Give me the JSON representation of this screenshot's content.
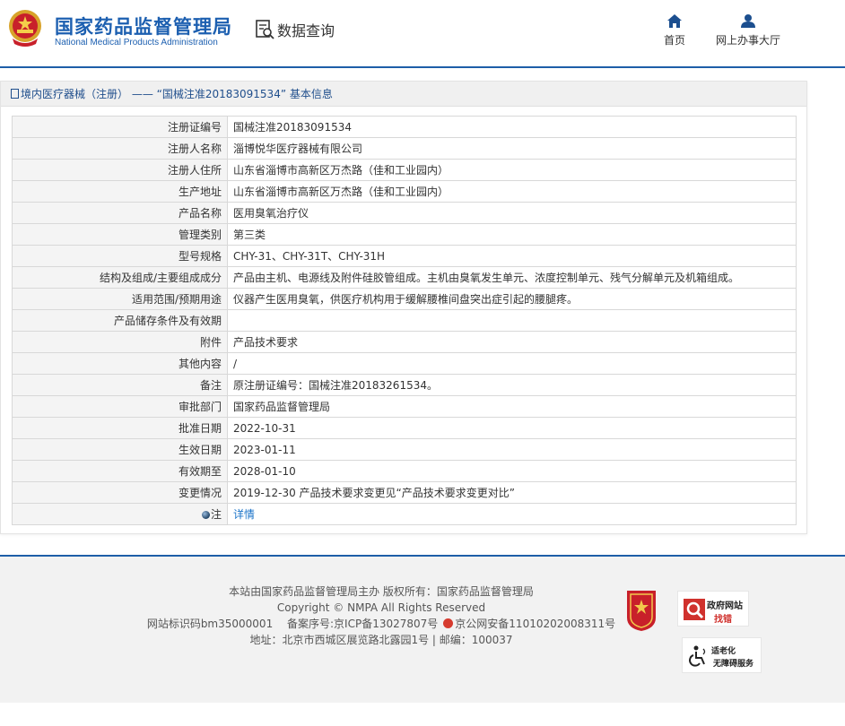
{
  "header": {
    "brand_cn": "国家药品监督管理局",
    "brand_en": "National Medical Products Administration",
    "query_label": "数据查询",
    "nav": {
      "home": "首页",
      "hall": "网上办事大厅"
    }
  },
  "breadcrumb": "境内医疗器械（注册） —— “国械注准20183091534” 基本信息",
  "fields": [
    {
      "label": "注册证编号",
      "value": "国械注准20183091534"
    },
    {
      "label": "注册人名称",
      "value": "淄博悦华医疗器械有限公司"
    },
    {
      "label": "注册人住所",
      "value": "山东省淄博市高新区万杰路（佳和工业园内）"
    },
    {
      "label": "生产地址",
      "value": "山东省淄博市高新区万杰路（佳和工业园内）"
    },
    {
      "label": "产品名称",
      "value": "医用臭氧治疗仪"
    },
    {
      "label": "管理类别",
      "value": "第三类"
    },
    {
      "label": "型号规格",
      "value": "CHY-31、CHY-31T、CHY-31H"
    },
    {
      "label": "结构及组成/主要组成成分",
      "value": "产品由主机、电源线及附件硅胶管组成。主机由臭氧发生单元、浓度控制单元、残气分解单元及机箱组成。"
    },
    {
      "label": "适用范围/预期用途",
      "value": "仪器产生医用臭氧，供医疗机构用于缓解腰椎间盘突出症引起的腰腿疼。"
    },
    {
      "label": "产品储存条件及有效期",
      "value": ""
    },
    {
      "label": "附件",
      "value": "产品技术要求"
    },
    {
      "label": "其他内容",
      "value": "/"
    },
    {
      "label": "备注",
      "value": "原注册证编号：国械注准20183261534。"
    },
    {
      "label": "审批部门",
      "value": "国家药品监督管理局"
    },
    {
      "label": "批准日期",
      "value": "2022-10-31"
    },
    {
      "label": "生效日期",
      "value": "2023-01-11"
    },
    {
      "label": "有效期至",
      "value": "2028-01-10"
    },
    {
      "label": "变更情况",
      "value": "2019-12-30 产品技术要求变更见“产品技术要求变更对比”"
    }
  ],
  "note_row": {
    "label": "注",
    "link": "详情"
  },
  "footer": {
    "line1": "本站由国家药品监督管理局主办 版权所有：国家药品监督管理局",
    "line2": "Copyright © NMPA All Rights Reserved",
    "line3a": "网站标识码bm35000001　 备案序号:京ICP备13027807号",
    "line3b": "京公网安备11010202008311号",
    "line4": "地址：北京市西城区展览路北露园1号 | 邮编：100037",
    "gov_badge_1": "政府网站",
    "gov_badge_2": "找错",
    "access_1": "适老化",
    "access_2": "无障碍服务"
  },
  "colors": {
    "brand_blue": "#1c5fb0",
    "link_blue": "#1a73c8",
    "label_bg": "#f4f4f4"
  }
}
